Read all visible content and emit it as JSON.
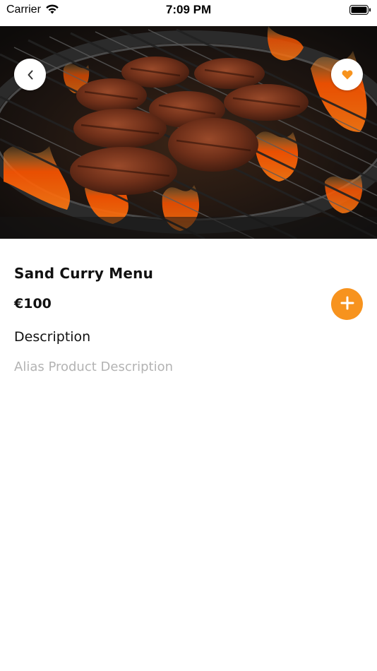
{
  "status_bar": {
    "carrier": "Carrier",
    "time": "7:09 PM",
    "wifi_icon": "wifi-icon",
    "battery_icon": "battery-icon"
  },
  "hero": {
    "image": "grilled-burger-patties-photo",
    "back_icon": "chevron-left-icon",
    "favorite_icon": "heart-icon"
  },
  "product": {
    "title": "Sand Curry Menu",
    "price": "€100",
    "add_icon": "plus-icon",
    "description_heading": "Description",
    "description_text": "Alias Product Description"
  },
  "colors": {
    "accent": "#f7931e",
    "title_text": "#111111",
    "muted_text": "#b3b3b3",
    "background": "#ffffff"
  }
}
